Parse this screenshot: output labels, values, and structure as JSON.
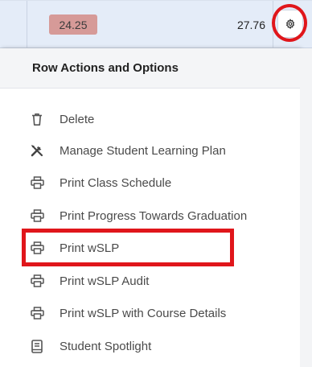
{
  "row": {
    "value1": "24.25",
    "value2": "27.76",
    "badge_color": "#d69a98",
    "settings_icon": "gear-icon"
  },
  "menu": {
    "title": "Row Actions and Options",
    "items": [
      {
        "label": "Delete",
        "icon": "trash-icon"
      },
      {
        "label": "Manage Student Learning Plan",
        "icon": "tools-icon"
      },
      {
        "label": "Print Class Schedule",
        "icon": "printer-icon"
      },
      {
        "label": "Print Progress Towards Graduation",
        "icon": "printer-icon"
      },
      {
        "label": "Print wSLP",
        "icon": "printer-icon"
      },
      {
        "label": "Print wSLP Audit",
        "icon": "printer-icon"
      },
      {
        "label": "Print wSLP with Course Details",
        "icon": "printer-icon"
      },
      {
        "label": "Student Spotlight",
        "icon": "notebook-icon"
      }
    ]
  },
  "annotation_color": "#e0161b"
}
